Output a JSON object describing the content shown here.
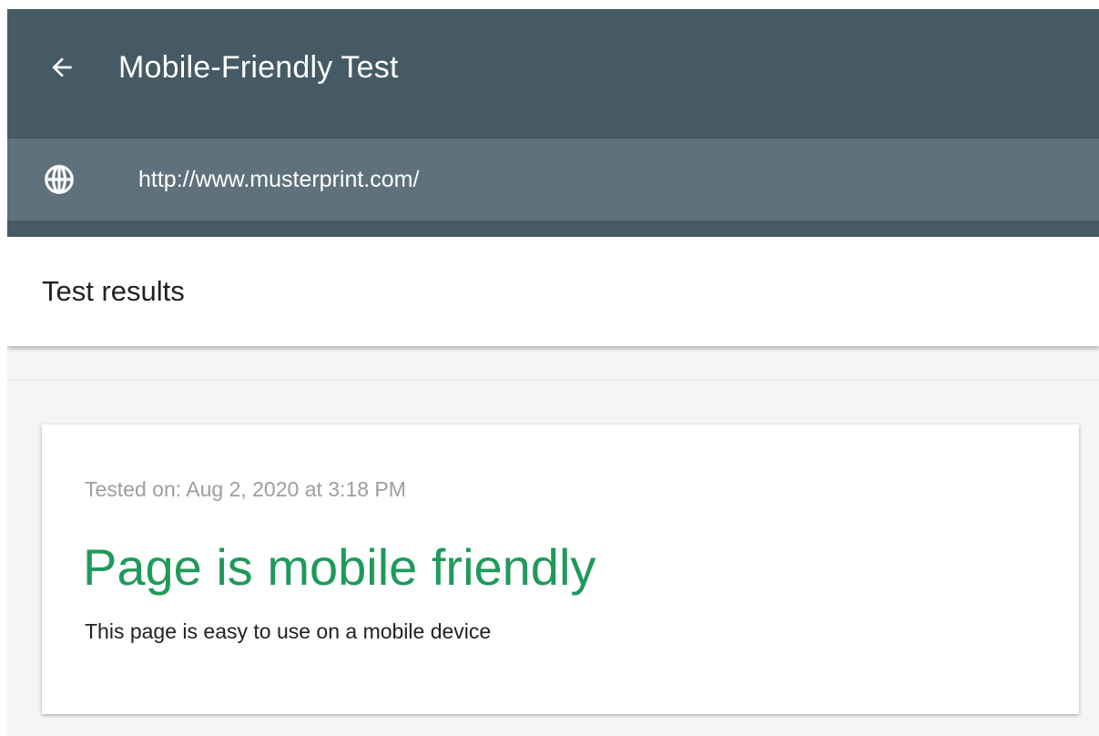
{
  "header": {
    "title": "Mobile-Friendly Test",
    "back_icon": "arrow-back-icon",
    "background_color": "#455a64"
  },
  "url_bar": {
    "icon": "globe-icon",
    "value": "http://www.musterprint.com/",
    "background_color": "#5f727b"
  },
  "results": {
    "title": "Test results"
  },
  "result_card": {
    "tested_on": "Tested on: Aug 2, 2020 at 3:18 PM",
    "verdict": "Page is mobile friendly",
    "verdict_color": "#1e9a5a",
    "description": "This page is easy to use on a mobile device"
  }
}
